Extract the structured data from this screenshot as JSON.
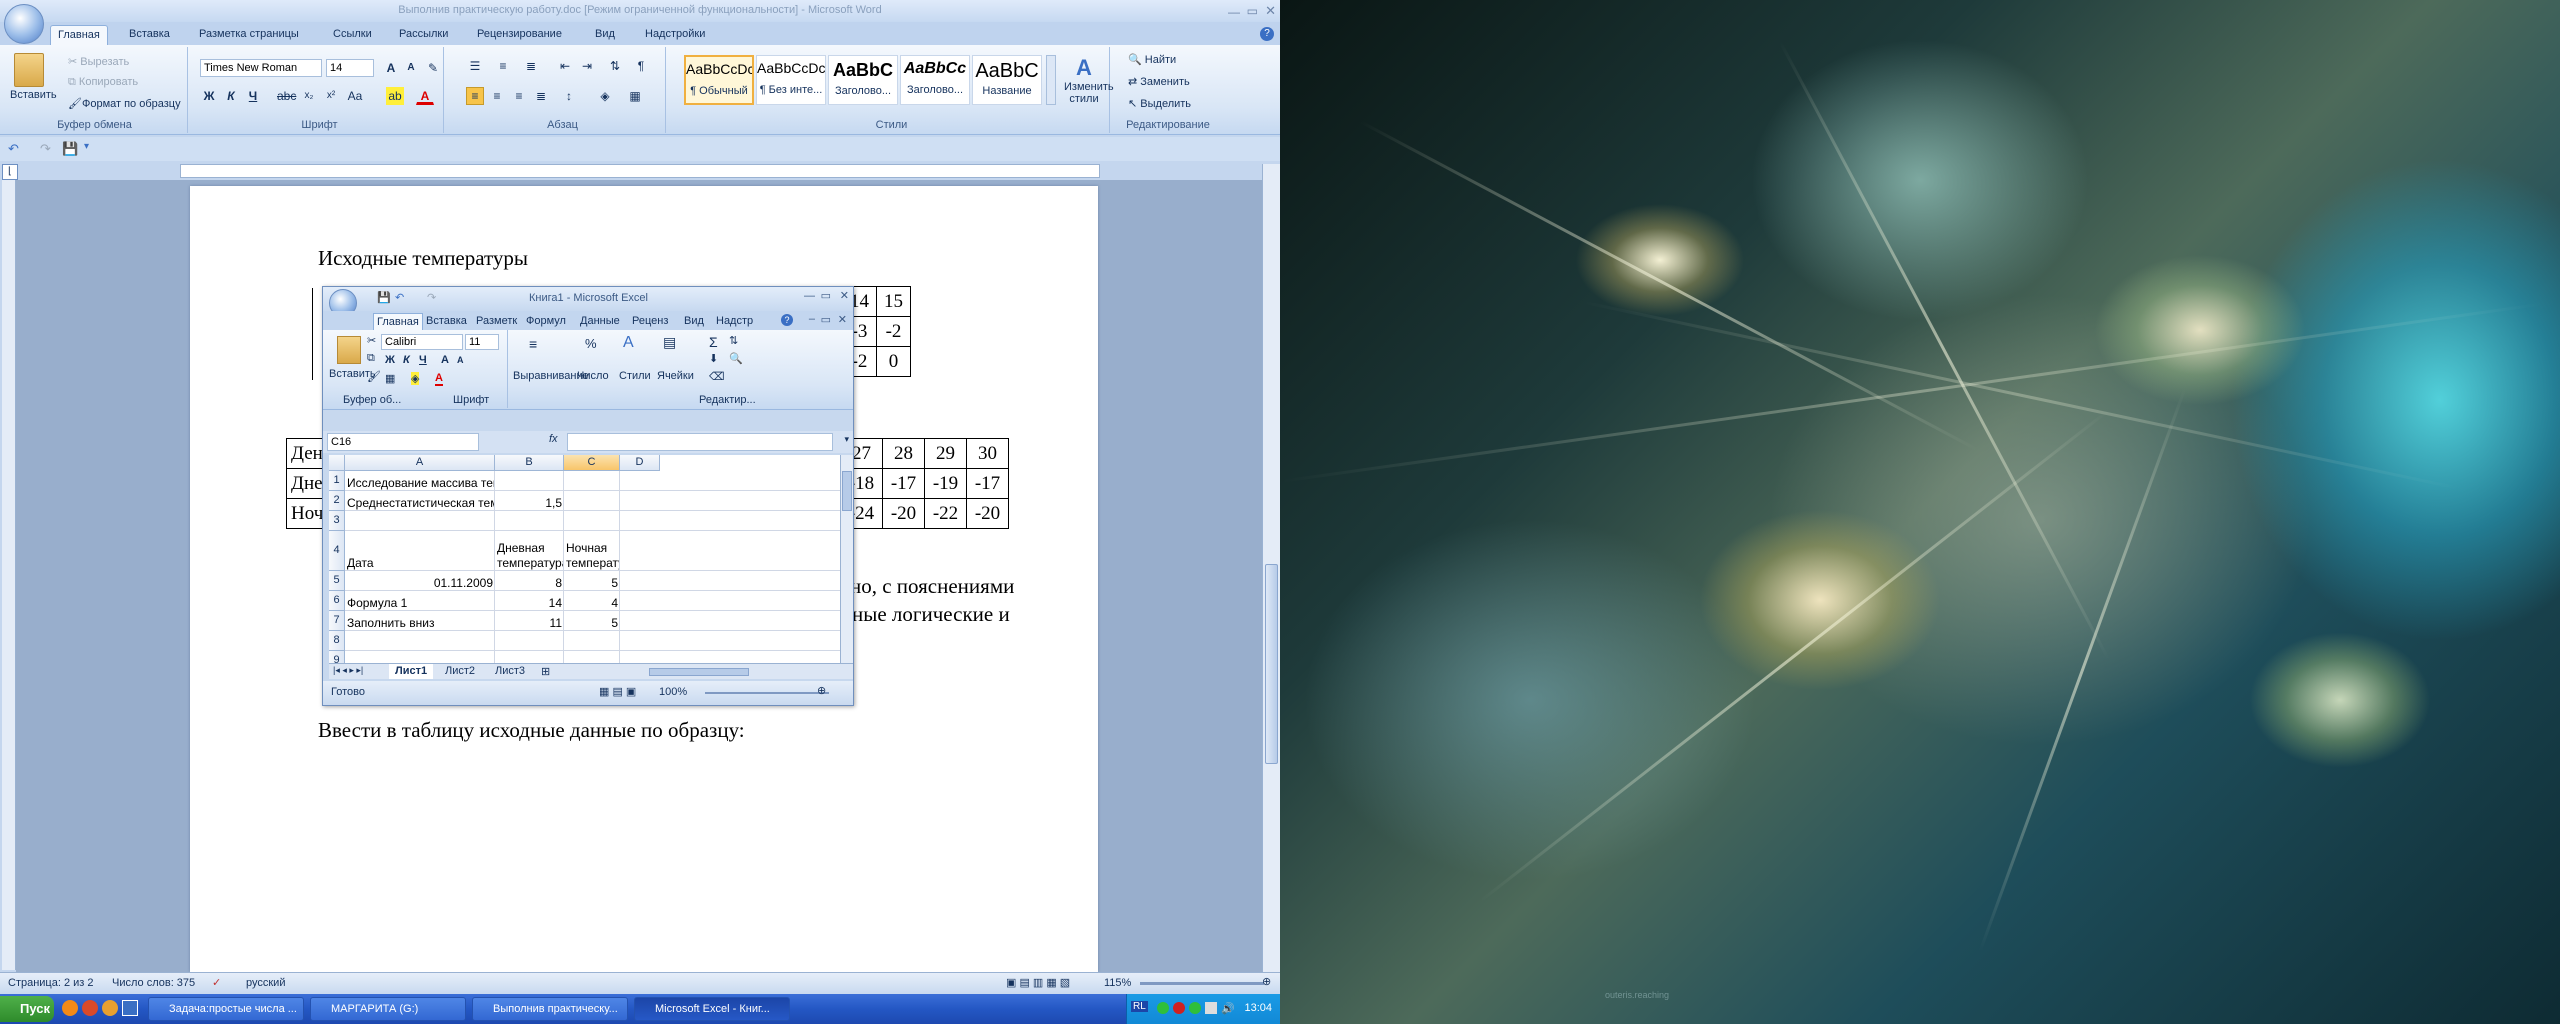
{
  "word": {
    "title": "Выполнив практическую работу.doc [Режим ограниченной функциональности] - Microsoft Word",
    "tabs": [
      "Главная",
      "Вставка",
      "Разметка страницы",
      "Ссылки",
      "Рассылки",
      "Рецензирование",
      "Вид",
      "Надстройки"
    ],
    "clipboard": {
      "paste": "Вставить",
      "cut": "Вырезать",
      "copy": "Копировать",
      "format_painter": "Формат по образцу",
      "label": "Буфер обмена"
    },
    "font": {
      "name": "Times New Roman",
      "size": "14",
      "label": "Шрифт"
    },
    "paragraph_label": "Абзац",
    "styles": {
      "items": [
        {
          "preview": "AaBbCcDc",
          "name": "¶ Обычный"
        },
        {
          "preview": "AaBbCcDc",
          "name": "¶ Без инте..."
        },
        {
          "preview": "AaBbC",
          "name": "Заголово..."
        },
        {
          "preview": "AaBbCc",
          "name": "Заголово..."
        },
        {
          "preview": "AaBbC",
          "name": "Название"
        }
      ],
      "change": "Изменить стили",
      "label": "Стили"
    },
    "editing": {
      "find": "Найти",
      "replace": "Заменить",
      "select": "Выделить",
      "label": "Редактирование"
    },
    "doc": {
      "heading": "Исходные температуры",
      "table1_tail": [
        [
          "14",
          "15"
        ],
        [
          "-3",
          "-2"
        ],
        [
          "-2",
          "0"
        ]
      ],
      "table1_partial": "0",
      "table2_first_col": [
        "Ден",
        "Дне",
        "Ноч"
      ],
      "table2_tail": [
        [
          "27",
          "28",
          "29",
          "30"
        ],
        [
          "-18",
          "-17",
          "-19",
          "-17"
        ],
        [
          "-24",
          "-20",
          "-22",
          "-20"
        ]
      ],
      "para_right1": "но, с пояснениями",
      "para_right2": "ные логические и",
      "instruction": "Ввести в таблицу исходные данные по образцу:"
    },
    "status": {
      "page": "Страница: 2 из 2",
      "words": "Число слов: 375",
      "lang": "русский",
      "zoom": "115%"
    }
  },
  "excel": {
    "title": "Книга1 - Microsoft Excel",
    "tabs": [
      "Главная",
      "Вставка",
      "Разметк",
      "Формул",
      "Данные",
      "Реценз",
      "Вид",
      "Надстр"
    ],
    "ribbon": {
      "paste": "Вставить",
      "font": "Calibri",
      "size": "11",
      "align": "Выравнивание",
      "number": "Число",
      "styles": "Стили",
      "cells": "Ячейки",
      "clip_label": "Буфер об...",
      "font_label": "Шрифт",
      "edit_label": "Редактир..."
    },
    "namebox": "C16",
    "fx": "fx",
    "columns": [
      "A",
      "B",
      "C",
      "D"
    ],
    "rows": [
      {
        "n": "1",
        "a": "Исследование массива температур",
        "b": "",
        "c": ""
      },
      {
        "n": "2",
        "a": "Среднестатистическая температура",
        "b": "1,5",
        "c": ""
      },
      {
        "n": "3",
        "a": "",
        "b": "",
        "c": ""
      },
      {
        "n": "4",
        "a": "Дата",
        "b": "Дневная температура",
        "c": "Ночная температура"
      },
      {
        "n": "5",
        "a": "01.11.2009",
        "b": "8",
        "c": "5"
      },
      {
        "n": "6",
        "a": "Формула 1",
        "b": "14",
        "c": "4"
      },
      {
        "n": "7",
        "a": "Заполнить вниз",
        "b": "11",
        "c": "5"
      },
      {
        "n": "8",
        "a": "",
        "b": "",
        "c": ""
      },
      {
        "n": "9",
        "a": "",
        "b": "",
        "c": ""
      }
    ],
    "sheets": [
      "Лист1",
      "Лист2",
      "Лист3"
    ],
    "status": "Готово",
    "zoom": "100%"
  },
  "taskbar": {
    "start": "Пуск",
    "buttons": [
      "Задача:простые числа ...",
      "МАРГАРИТА (G:)",
      "Выполнив практическу...",
      "Microsoft Excel - Книг..."
    ],
    "clock": "13:04",
    "lang": "RL"
  },
  "wallpaper_signature": "outeris.reaching"
}
